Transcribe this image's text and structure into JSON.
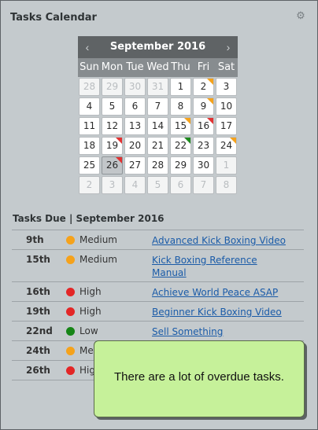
{
  "panel": {
    "title": "Tasks Calendar",
    "icon": "gear-icon"
  },
  "calendar": {
    "month": "September 2016",
    "prev": "‹",
    "next": "›",
    "weekdays": [
      "Sun",
      "Mon",
      "Tue",
      "Wed",
      "Thu",
      "Fri",
      "Sat"
    ],
    "weeks": [
      [
        {
          "d": "28",
          "out": true
        },
        {
          "d": "29",
          "out": true
        },
        {
          "d": "30",
          "out": true
        },
        {
          "d": "31",
          "out": true
        },
        {
          "d": "1"
        },
        {
          "d": "2",
          "flag": "orange"
        },
        {
          "d": "3"
        }
      ],
      [
        {
          "d": "4"
        },
        {
          "d": "5"
        },
        {
          "d": "6"
        },
        {
          "d": "7"
        },
        {
          "d": "8"
        },
        {
          "d": "9",
          "flag": "orange"
        },
        {
          "d": "10"
        }
      ],
      [
        {
          "d": "11"
        },
        {
          "d": "12"
        },
        {
          "d": "13"
        },
        {
          "d": "14"
        },
        {
          "d": "15",
          "flag": "orange"
        },
        {
          "d": "16",
          "flag": "red"
        },
        {
          "d": "17"
        }
      ],
      [
        {
          "d": "18"
        },
        {
          "d": "19",
          "flag": "red"
        },
        {
          "d": "20"
        },
        {
          "d": "21"
        },
        {
          "d": "22",
          "flag": "green"
        },
        {
          "d": "23"
        },
        {
          "d": "24",
          "flag": "orange"
        }
      ],
      [
        {
          "d": "25"
        },
        {
          "d": "26",
          "flag": "red",
          "today": true
        },
        {
          "d": "27"
        },
        {
          "d": "28"
        },
        {
          "d": "29"
        },
        {
          "d": "30"
        },
        {
          "d": "1",
          "out": true
        }
      ],
      [
        {
          "d": "2",
          "out": true
        },
        {
          "d": "3",
          "out": true
        },
        {
          "d": "4",
          "out": true
        },
        {
          "d": "5",
          "out": true
        },
        {
          "d": "6",
          "out": true
        },
        {
          "d": "7",
          "out": true
        },
        {
          "d": "8",
          "out": true
        }
      ]
    ]
  },
  "tasks_due": {
    "heading": "Tasks Due  |  September 2016",
    "items": [
      {
        "date": "9th",
        "priority": "Medium",
        "color": "orange",
        "name": "Advanced Kick Boxing Video",
        "h": 24
      },
      {
        "date": "15th",
        "priority": "Medium",
        "color": "orange",
        "name": "Kick Boxing Reference Manual",
        "h": 40
      },
      {
        "date": "16th",
        "priority": "High",
        "color": "red",
        "name": "Achieve World Peace ASAP",
        "h": 24
      },
      {
        "date": "19th",
        "priority": "High",
        "color": "red",
        "name": "Beginner Kick Boxing Video",
        "h": 24
      },
      {
        "date": "22nd",
        "priority": "Low",
        "color": "green",
        "name": "Sell Something",
        "h": 24
      },
      {
        "date": "24th",
        "priority": "Medium",
        "color": "orange",
        "name": "",
        "h": 24
      },
      {
        "date": "26th",
        "priority": "High",
        "color": "red",
        "name": "",
        "h": 24
      }
    ]
  },
  "tooltip": {
    "text": "There are a lot of overdue tasks."
  }
}
